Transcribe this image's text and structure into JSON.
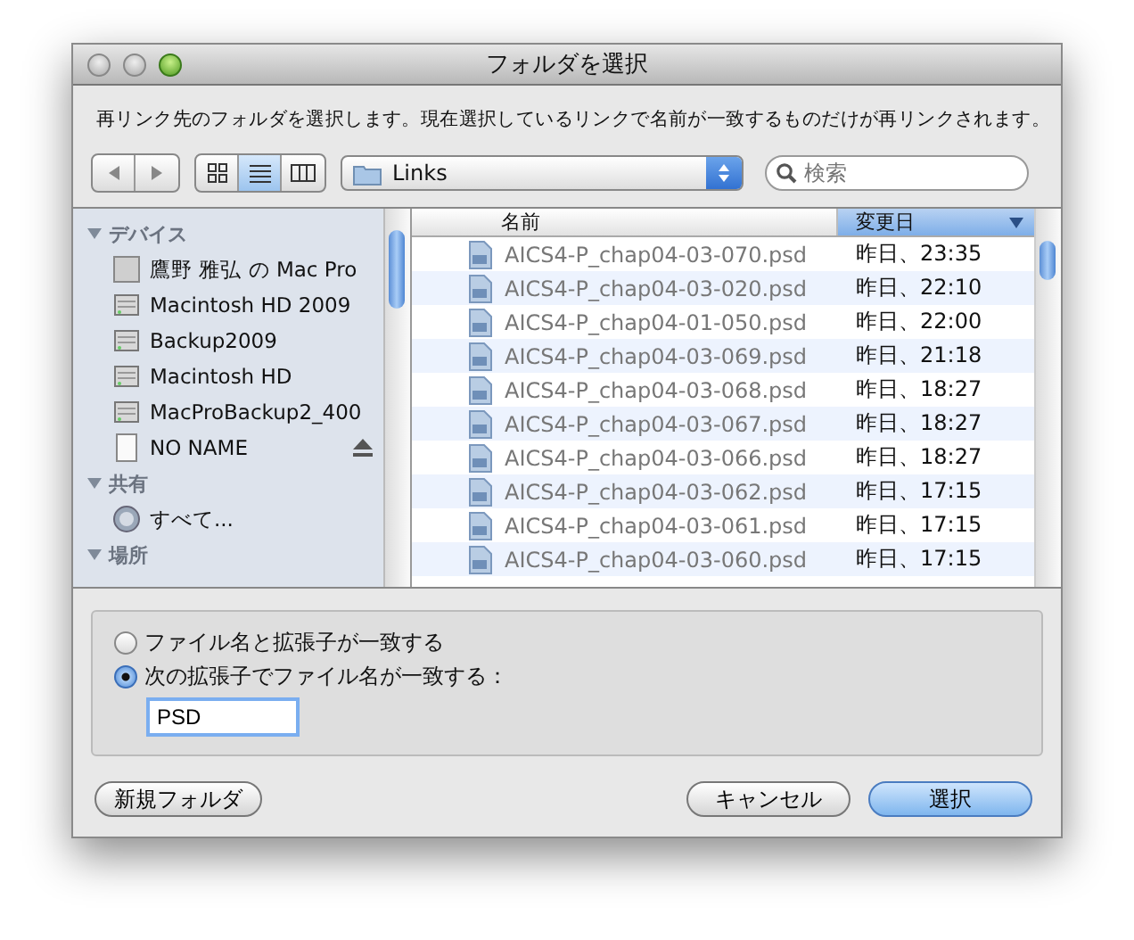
{
  "window": {
    "title": "フォルダを選択"
  },
  "instruction": "再リンク先のフォルダを選択します。現在選択しているリンクで名前が一致するものだけが再リンクされます。",
  "view_modes": [
    {
      "kind": "icons",
      "selected": false
    },
    {
      "kind": "list",
      "selected": true
    },
    {
      "kind": "columns",
      "selected": false
    }
  ],
  "location": {
    "label": "Links"
  },
  "search": {
    "placeholder": "検索"
  },
  "sidebar": {
    "sections": [
      {
        "label": "デバイス",
        "expanded": true,
        "children": [
          {
            "label": "鷹野 雅弘 の Mac Pro",
            "kind": "computer",
            "eject": false
          },
          {
            "label": "Macintosh HD 2009",
            "kind": "disk",
            "eject": false
          },
          {
            "label": "Backup2009",
            "kind": "disk",
            "eject": false
          },
          {
            "label": "Macintosh HD",
            "kind": "disk",
            "eject": false
          },
          {
            "label": "MacProBackup2_400",
            "kind": "disk",
            "eject": false
          },
          {
            "label": "NO NAME",
            "kind": "removable",
            "eject": true
          }
        ]
      },
      {
        "label": "共有",
        "expanded": true,
        "children": [
          {
            "label": "すべて...",
            "kind": "network",
            "eject": false
          }
        ]
      },
      {
        "label": "場所",
        "expanded": true
      }
    ]
  },
  "table": {
    "columns": [
      {
        "label": "名前",
        "selected": false
      },
      {
        "label": "変更日",
        "selected": true
      }
    ],
    "rows": [
      {
        "name": "AICS4-P_chap04-03-070.psd",
        "date": "昨日、23:35"
      },
      {
        "name": "AICS4-P_chap04-03-020.psd",
        "date": "昨日、22:10"
      },
      {
        "name": "AICS4-P_chap04-01-050.psd",
        "date": "昨日、22:00"
      },
      {
        "name": "AICS4-P_chap04-03-069.psd",
        "date": "昨日、21:18"
      },
      {
        "name": "AICS4-P_chap04-03-068.psd",
        "date": "昨日、18:27"
      },
      {
        "name": "AICS4-P_chap04-03-067.psd",
        "date": "昨日、18:27"
      },
      {
        "name": "AICS4-P_chap04-03-066.psd",
        "date": "昨日、18:27"
      },
      {
        "name": "AICS4-P_chap04-03-062.psd",
        "date": "昨日、17:15"
      },
      {
        "name": "AICS4-P_chap04-03-061.psd",
        "date": "昨日、17:15"
      },
      {
        "name": "AICS4-P_chap04-03-060.psd",
        "date": "昨日、17:15"
      }
    ]
  },
  "match_options": [
    {
      "label": "ファイル名と拡張子が一致する",
      "selected": false
    },
    {
      "label": "次の拡張子でファイル名が一致する：",
      "selected": true
    }
  ],
  "extension": {
    "value": "PSD"
  },
  "buttons": [
    {
      "label": "新規フォルダ",
      "kind": "secondary"
    },
    {
      "label": "キャンセル",
      "kind": "normal"
    },
    {
      "label": "選択",
      "kind": "default"
    }
  ]
}
